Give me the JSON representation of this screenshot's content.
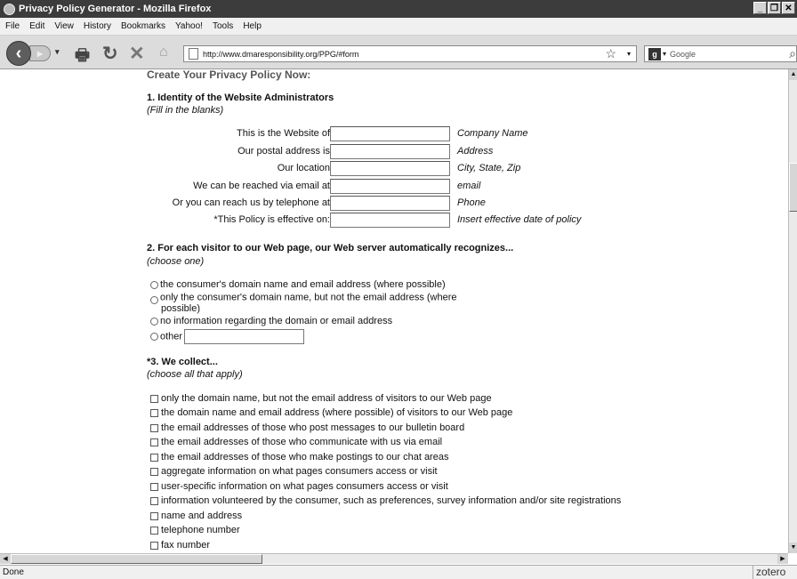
{
  "window": {
    "title": "Privacy Policy Generator - Mozilla Firefox"
  },
  "menu": [
    "File",
    "Edit",
    "View",
    "History",
    "Bookmarks",
    "Yahoo!",
    "Tools",
    "Help"
  ],
  "nav": {
    "url": "http://www.dmaresponsibility.org/PPG/#form",
    "search_placeholder": "Google"
  },
  "page": {
    "heading": "Create Your Privacy Policy Now:",
    "s1": {
      "title": "1. Identity of the Website Administrators",
      "sub": "(Fill in the blanks)",
      "fields": [
        {
          "label": "This is the Website of",
          "hint": "Company Name"
        },
        {
          "label": "Our postal address is",
          "hint": "Address"
        },
        {
          "label": "Our location",
          "hint": "City, State, Zip"
        },
        {
          "label": "We can be reached via  email at",
          "hint": "email"
        },
        {
          "label": "Or you can reach us by  telephone at",
          "hint": "Phone"
        },
        {
          "label": "*This Policy is effective on:",
          "hint": "Insert effective date of policy"
        }
      ]
    },
    "s2": {
      "title": "2. For each visitor to our Web page, our Web server automatically recognizes...",
      "sub": "(choose one)",
      "options": [
        "the consumer's domain name and email address (where possible)",
        "only the consumer's domain name, but not the email address (where",
        "possible)",
        "no information regarding the domain or email address",
        "other"
      ]
    },
    "s3": {
      "title": "*3. We collect...",
      "sub": "(choose all that apply)",
      "options": [
        "only the domain name, but not the email address of visitors to our Web page",
        "the domain name and email address (where possible) of visitors to our Web page",
        "the email addresses of those who post messages to our bulletin board",
        "the email addresses of those who communicate with us via email",
        "the email addresses of those who make postings to our chat areas",
        "aggregate information on what pages consumers access or visit",
        "user-specific information on what pages consumers access or visit",
        "information volunteered by the consumer, such as preferences, survey information and/or site registrations",
        "name and address",
        "telephone number",
        "fax number"
      ]
    }
  },
  "status": {
    "text": "Done",
    "addon": "zotero"
  }
}
